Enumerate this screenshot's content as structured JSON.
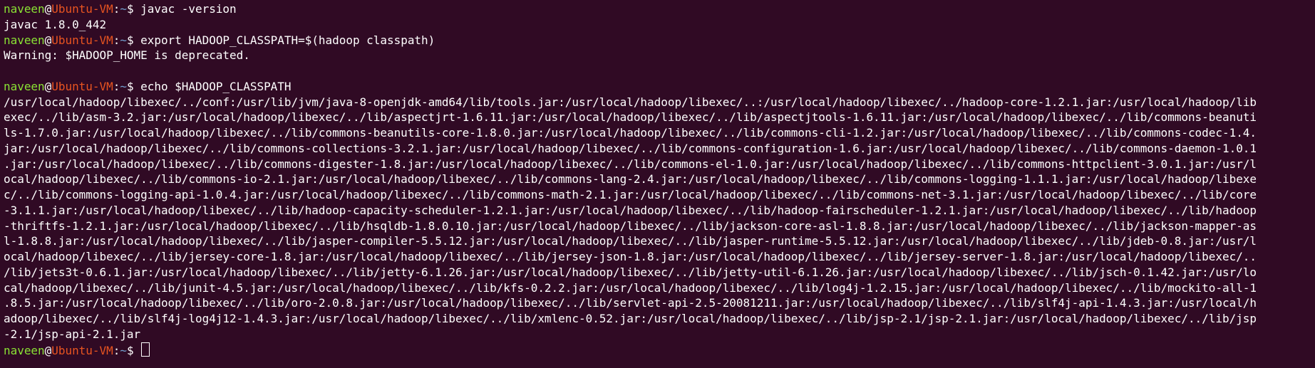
{
  "colors": {
    "background": "#300a24",
    "text": "#ffffff",
    "user": "#8ae234",
    "host": "#e95420",
    "path": "#729fcf"
  },
  "prompt": {
    "user": "naveen",
    "at": "@",
    "host": "Ubuntu-VM",
    "sep": ":",
    "path": "~",
    "symbol": "$ "
  },
  "session": {
    "cmd1": "javac -version",
    "out1": "javac 1.8.0_442",
    "cmd2": "export HADOOP_CLASSPATH=$(hadoop classpath)",
    "out2": "Warning: $HADOOP_HOME is deprecated.",
    "cmd3": "echo $HADOOP_CLASSPATH",
    "cmd4": ""
  },
  "classpath_lines": [
    "/usr/local/hadoop/libexec/../conf:/usr/lib/jvm/java-8-openjdk-amd64/lib/tools.jar:/usr/local/hadoop/libexec/..:/usr/local/hadoop/libexec/../hadoop-core-1.2.1.jar:/usr/local/hadoop/lib",
    "exec/../lib/asm-3.2.jar:/usr/local/hadoop/libexec/../lib/aspectjrt-1.6.11.jar:/usr/local/hadoop/libexec/../lib/aspectjtools-1.6.11.jar:/usr/local/hadoop/libexec/../lib/commons-beanuti",
    "ls-1.7.0.jar:/usr/local/hadoop/libexec/../lib/commons-beanutils-core-1.8.0.jar:/usr/local/hadoop/libexec/../lib/commons-cli-1.2.jar:/usr/local/hadoop/libexec/../lib/commons-codec-1.4.",
    "jar:/usr/local/hadoop/libexec/../lib/commons-collections-3.2.1.jar:/usr/local/hadoop/libexec/../lib/commons-configuration-1.6.jar:/usr/local/hadoop/libexec/../lib/commons-daemon-1.0.1",
    ".jar:/usr/local/hadoop/libexec/../lib/commons-digester-1.8.jar:/usr/local/hadoop/libexec/../lib/commons-el-1.0.jar:/usr/local/hadoop/libexec/../lib/commons-httpclient-3.0.1.jar:/usr/l",
    "ocal/hadoop/libexec/../lib/commons-io-2.1.jar:/usr/local/hadoop/libexec/../lib/commons-lang-2.4.jar:/usr/local/hadoop/libexec/../lib/commons-logging-1.1.1.jar:/usr/local/hadoop/libexe",
    "c/../lib/commons-logging-api-1.0.4.jar:/usr/local/hadoop/libexec/../lib/commons-math-2.1.jar:/usr/local/hadoop/libexec/../lib/commons-net-3.1.jar:/usr/local/hadoop/libexec/../lib/core",
    "-3.1.1.jar:/usr/local/hadoop/libexec/../lib/hadoop-capacity-scheduler-1.2.1.jar:/usr/local/hadoop/libexec/../lib/hadoop-fairscheduler-1.2.1.jar:/usr/local/hadoop/libexec/../lib/hadoop",
    "-thriftfs-1.2.1.jar:/usr/local/hadoop/libexec/../lib/hsqldb-1.8.0.10.jar:/usr/local/hadoop/libexec/../lib/jackson-core-asl-1.8.8.jar:/usr/local/hadoop/libexec/../lib/jackson-mapper-as",
    "l-1.8.8.jar:/usr/local/hadoop/libexec/../lib/jasper-compiler-5.5.12.jar:/usr/local/hadoop/libexec/../lib/jasper-runtime-5.5.12.jar:/usr/local/hadoop/libexec/../lib/jdeb-0.8.jar:/usr/l",
    "ocal/hadoop/libexec/../lib/jersey-core-1.8.jar:/usr/local/hadoop/libexec/../lib/jersey-json-1.8.jar:/usr/local/hadoop/libexec/../lib/jersey-server-1.8.jar:/usr/local/hadoop/libexec/..",
    "/lib/jets3t-0.6.1.jar:/usr/local/hadoop/libexec/../lib/jetty-6.1.26.jar:/usr/local/hadoop/libexec/../lib/jetty-util-6.1.26.jar:/usr/local/hadoop/libexec/../lib/jsch-0.1.42.jar:/usr/lo",
    "cal/hadoop/libexec/../lib/junit-4.5.jar:/usr/local/hadoop/libexec/../lib/kfs-0.2.2.jar:/usr/local/hadoop/libexec/../lib/log4j-1.2.15.jar:/usr/local/hadoop/libexec/../lib/mockito-all-1",
    ".8.5.jar:/usr/local/hadoop/libexec/../lib/oro-2.0.8.jar:/usr/local/hadoop/libexec/../lib/servlet-api-2.5-20081211.jar:/usr/local/hadoop/libexec/../lib/slf4j-api-1.4.3.jar:/usr/local/h",
    "adoop/libexec/../lib/slf4j-log4j12-1.4.3.jar:/usr/local/hadoop/libexec/../lib/xmlenc-0.52.jar:/usr/local/hadoop/libexec/../lib/jsp-2.1/jsp-2.1.jar:/usr/local/hadoop/libexec/../lib/jsp",
    "-2.1/jsp-api-2.1.jar"
  ]
}
